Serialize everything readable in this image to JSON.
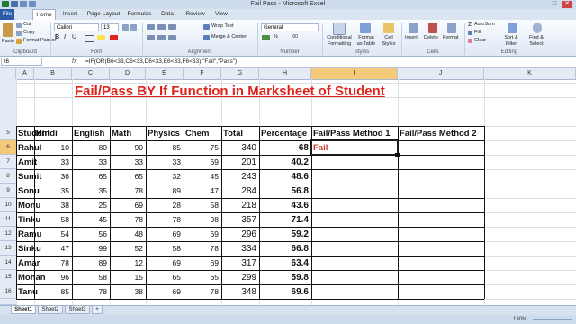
{
  "window": {
    "title": "Fail Pass  -  Microsoft Excel",
    "minimize": "–",
    "maximize": "□",
    "close": "✕"
  },
  "tabs": [
    "File",
    "Home",
    "Insert",
    "Page Layout",
    "Formulas",
    "Data",
    "Review",
    "View"
  ],
  "ribbon": {
    "clipboard": {
      "paste": "Paste",
      "cut": "Cut",
      "copy": "Copy",
      "format_painter": "Format Painter",
      "label": "Clipboard"
    },
    "font": {
      "name": "Calibri",
      "size": "13",
      "label": "Font"
    },
    "alignment": {
      "wrap": "Wrap Text",
      "merge": "Merge & Center",
      "label": "Alignment"
    },
    "number": {
      "format": "General",
      "label": "Number"
    },
    "styles": {
      "conditional": "Conditional Formatting",
      "table": "Format as Table",
      "cell": "Cell Styles",
      "label": "Styles"
    },
    "cells": {
      "insert": "Insert",
      "delete": "Delete",
      "format": "Format",
      "label": "Cells"
    },
    "editing": {
      "autosum": "AutoSum",
      "fill": "Fill",
      "clear": "Clear",
      "sort": "Sort & Filter",
      "find": "Find & Select",
      "label": "Editing"
    }
  },
  "formula_bar": {
    "name_box": "I6",
    "fx": "fx",
    "formula": "=IF(OR(B6<33,C6<33,D6<33,E6<33,F6<33),\"Fail\",\"Pass\")"
  },
  "columns": [
    "A",
    "B",
    "C",
    "D",
    "E",
    "F",
    "G",
    "H",
    "I",
    "J",
    "K"
  ],
  "selected_column": "I",
  "sheet_title": "Fail/Pass BY If Function in Marksheet of Student",
  "table": {
    "headers": [
      "Student",
      "Hindi",
      "English",
      "Math",
      "Physics",
      "Chem",
      "Total",
      "Percentage",
      "Fail/Pass Method 1",
      "Fail/Pass Method 2"
    ],
    "rows": [
      {
        "row": "6",
        "cells": [
          "Rahul",
          "10",
          "80",
          "90",
          "85",
          "75",
          "340",
          "68",
          "Fail",
          ""
        ]
      },
      {
        "row": "7",
        "cells": [
          "Amit",
          "33",
          "33",
          "33",
          "33",
          "69",
          "201",
          "40.2",
          "",
          ""
        ]
      },
      {
        "row": "8",
        "cells": [
          "Sumit",
          "36",
          "65",
          "65",
          "32",
          "45",
          "243",
          "48.6",
          "",
          ""
        ]
      },
      {
        "row": "9",
        "cells": [
          "Sonu",
          "35",
          "35",
          "78",
          "89",
          "47",
          "284",
          "56.8",
          "",
          ""
        ]
      },
      {
        "row": "10",
        "cells": [
          "Monu",
          "38",
          "25",
          "69",
          "28",
          "58",
          "218",
          "43.6",
          "",
          ""
        ]
      },
      {
        "row": "11",
        "cells": [
          "Tinku",
          "58",
          "45",
          "78",
          "78",
          "98",
          "357",
          "71.4",
          "",
          ""
        ]
      },
      {
        "row": "12",
        "cells": [
          "Ramu",
          "54",
          "56",
          "48",
          "69",
          "69",
          "296",
          "59.2",
          "",
          ""
        ]
      },
      {
        "row": "13",
        "cells": [
          "Sinku",
          "47",
          "99",
          "52",
          "58",
          "78",
          "334",
          "66.8",
          "",
          ""
        ]
      },
      {
        "row": "14",
        "cells": [
          "Amar",
          "78",
          "89",
          "12",
          "69",
          "69",
          "317",
          "63.4",
          "",
          ""
        ]
      },
      {
        "row": "15",
        "cells": [
          "Mohan",
          "96",
          "58",
          "15",
          "65",
          "65",
          "299",
          "59.8",
          "",
          ""
        ]
      },
      {
        "row": "16",
        "cells": [
          "Tanu",
          "85",
          "78",
          "38",
          "69",
          "78",
          "348",
          "69.6",
          "",
          ""
        ]
      }
    ]
  },
  "sheets": [
    "Sheet1",
    "Sheet2",
    "Sheet3"
  ],
  "active_sheet": "Sheet1",
  "status": {
    "zoom": "130%"
  },
  "colors": {
    "title_red": "#e0231a",
    "fail_text": "#c0392b",
    "selection": "#1a1a1a"
  }
}
